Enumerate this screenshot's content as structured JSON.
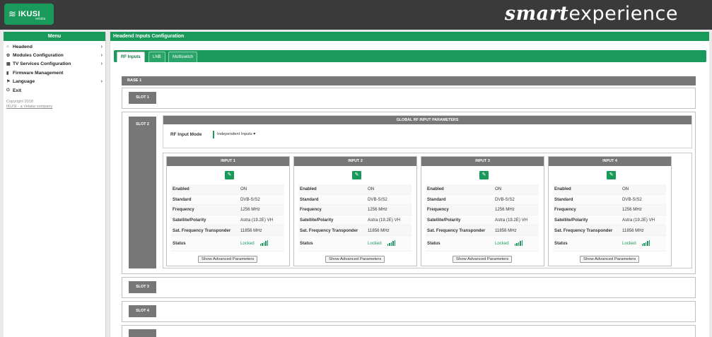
{
  "app": {
    "logo_text": "IKUSI",
    "logo_sub": "velatia",
    "brand_bold": "smart",
    "brand_rest": "experience"
  },
  "sidebar": {
    "title": "Menu",
    "items": [
      {
        "label": "Headend",
        "icon": "home-icon",
        "has_submenu": true
      },
      {
        "label": "Modules Configuration",
        "icon": "gear-icon",
        "has_submenu": true
      },
      {
        "label": "TV Services Configuration",
        "icon": "grid-icon",
        "has_submenu": true
      },
      {
        "label": "Firmware Management",
        "icon": "upload-icon",
        "has_submenu": false
      },
      {
        "label": "Language",
        "icon": "flag-icon",
        "has_submenu": true
      },
      {
        "label": "Exit",
        "icon": "power-icon",
        "has_submenu": false
      }
    ],
    "copyright": "Copyright 2018",
    "company_link": "IKUSI - a Velatia company"
  },
  "main": {
    "title": "Headend Inputs Configuration",
    "tabs": [
      {
        "label": "RF Inputs",
        "active": true
      },
      {
        "label": "LNB",
        "active": false
      },
      {
        "label": "Multiswitch",
        "active": false
      }
    ],
    "base_label": "BASE 1",
    "slots": {
      "slot1": "SLOT 1",
      "slot2": "SLOT 2",
      "slot3": "SLOT 3",
      "slot4": "SLOT 4"
    },
    "global": {
      "title": "GLOBAL RF INPUT PARAMETERS",
      "mode_label": "RF Input Mode",
      "mode_value": "Independent Inputs"
    },
    "param_labels": {
      "enabled": "Enabled",
      "standard": "Standard",
      "frequency": "Frequency",
      "satellite": "Satellite/Polarity",
      "transponder": "Sat. Frequency Transponder",
      "status": "Status"
    },
    "advanced_button": "Show Advanced Parameters",
    "inputs": [
      {
        "title": "INPUT 1",
        "enabled": "ON",
        "standard": "DVB-S/S2",
        "frequency": "1256 MHz",
        "satellite": "Astra (19.2E) VH",
        "transponder": "11856 MHz",
        "status": "Locked",
        "signal_level": 5
      },
      {
        "title": "INPUT 2",
        "enabled": "ON",
        "standard": "DVB-S/S2",
        "frequency": "1256 MHz",
        "satellite": "Astra (19.2E) VH",
        "transponder": "11856 MHz",
        "status": "Locked",
        "signal_level": 5
      },
      {
        "title": "INPUT 3",
        "enabled": "ON",
        "standard": "DVB-S/S2",
        "frequency": "1256 MHz",
        "satellite": "Astra (19.2E) VH",
        "transponder": "11856 MHz",
        "status": "Locked",
        "signal_level": 5
      },
      {
        "title": "INPUT 4",
        "enabled": "ON",
        "standard": "DVB-S/S2",
        "frequency": "1256 MHz",
        "satellite": "Astra (19.2E) VH",
        "transponder": "11856 MHz",
        "status": "Locked",
        "signal_level": 5
      }
    ]
  },
  "colors": {
    "accent": "#1a9a5a",
    "header_bg": "#3a3a3a",
    "panel_gray": "#777777"
  }
}
